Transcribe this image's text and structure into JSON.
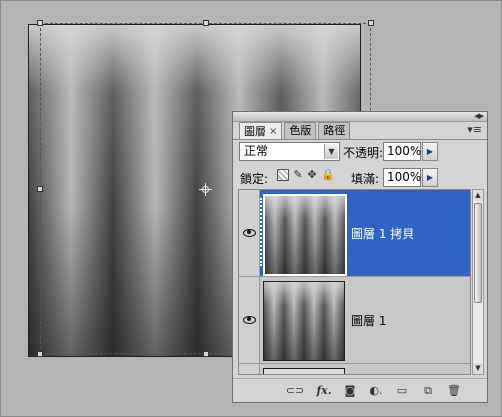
{
  "layers_panel": {
    "tabs": [
      {
        "label": "圖層",
        "active": true
      },
      {
        "label": "色版",
        "active": false
      },
      {
        "label": "路徑",
        "active": false
      }
    ],
    "blend_mode": "正常",
    "opacity_label": "不透明:",
    "opacity_value": "100%",
    "lock_label": "鎖定:",
    "fill_label": "填滿:",
    "fill_value": "100%",
    "layers": [
      {
        "name": "圖層 1 拷貝",
        "selected": true,
        "visible": true
      },
      {
        "name": "圖層 1",
        "selected": false,
        "visible": true
      }
    ],
    "bottom_icons": [
      "link-layers-icon",
      "fx-icon",
      "mask-icon",
      "adjustment-icon",
      "group-folder-icon",
      "new-layer-icon",
      "trash-icon"
    ],
    "fx_label": "fx."
  },
  "colors": {
    "selection_blue": "#2f64c5",
    "background": "#b4b4b4",
    "panel_bg": "#d4d4d4"
  }
}
